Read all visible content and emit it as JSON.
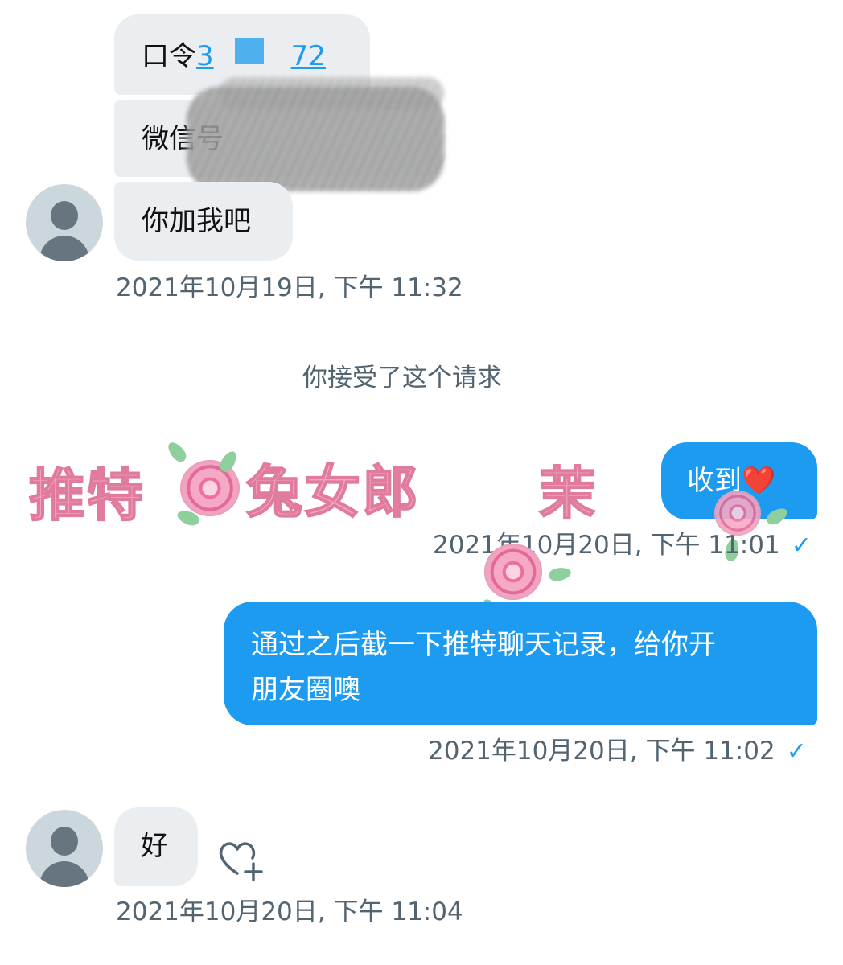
{
  "thread": {
    "msg1": {
      "password_label": "口令",
      "password_part1": "3",
      "password_part2": "72",
      "wechat_label": "微信号",
      "add_me": "你加我吧",
      "time": "2021年10月19日, 下午 11:32"
    },
    "system_notice": "你接受了这个请求",
    "msg2": {
      "text": "收到❤️",
      "time": "2021年10月20日, 下午 11:01"
    },
    "msg3": {
      "line1": "通过之后截一下推特聊天记录，给你开",
      "line2": "朋友圈噢",
      "time": "2021年10月20日, 下午 11:02"
    },
    "msg4": {
      "text": "好",
      "time": "2021年10月20日, 下午 11:04"
    },
    "read_mark": "✓"
  },
  "watermark": {
    "part1": "推特",
    "part2": "兔女郎",
    "part3": "茉"
  },
  "icons": {
    "avatar": "default-avatar-icon",
    "react": "heart-plus-icon",
    "read": "check-icon"
  },
  "colors": {
    "accent": "#1d9bf0",
    "incoming_bubble": "#ebeef0",
    "muted_text": "#536471",
    "avatar_bg": "#ccd6dd"
  }
}
